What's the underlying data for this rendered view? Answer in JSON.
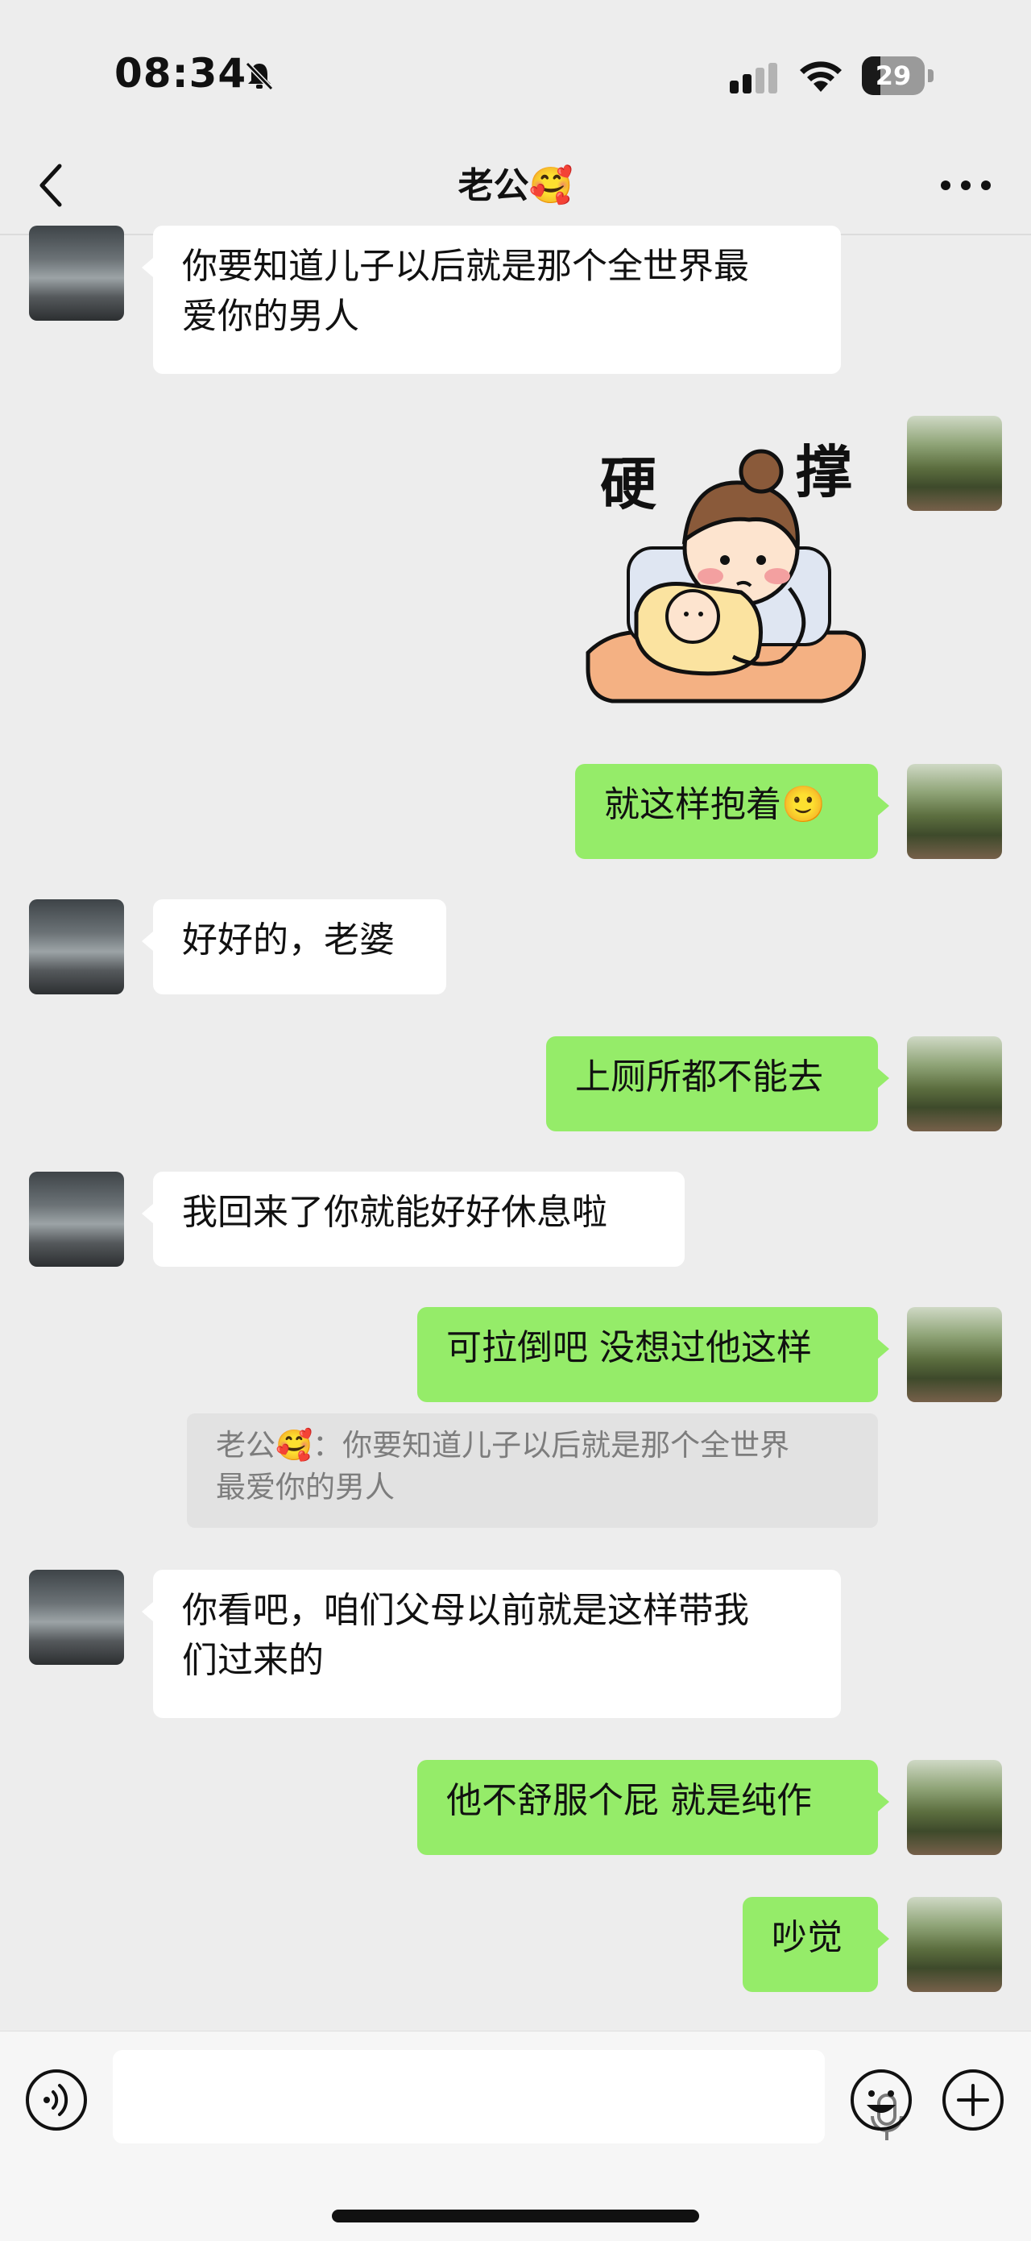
{
  "status_bar": {
    "time": "08:34",
    "battery": "29",
    "battery_level": 0.29
  },
  "nav": {
    "title": "老公🥰"
  },
  "messages": [
    {
      "from": "him",
      "text": "你要知道儿子以后就是那个全世界最\n爱你的男人"
    },
    {
      "from": "me",
      "type": "sticker",
      "caption": "硬撑"
    },
    {
      "from": "me",
      "text": "就这样抱着🙂"
    },
    {
      "from": "him",
      "text": "好好的，老婆"
    },
    {
      "from": "me",
      "text": "上厕所都不能去"
    },
    {
      "from": "him",
      "text": "我回来了你就能好好休息啦"
    },
    {
      "from": "me",
      "text": "可拉倒吧 没想过他这样",
      "quote": "老公🥰：你要知道儿子以后就是那个全世界\n最爱你的男人"
    },
    {
      "from": "him",
      "text": "你看吧，咱们父母以前就是这样带我\n们过来的"
    },
    {
      "from": "me",
      "text": "他不舒服个屁 就是纯作"
    },
    {
      "from": "me",
      "text": "吵觉"
    }
  ],
  "icons": {
    "back": "chevron-left-icon",
    "more": "more-dots-icon",
    "voice": "voice-input-icon",
    "mic": "microphone-icon",
    "emoji": "emoji-icon",
    "plus": "plus-icon"
  }
}
